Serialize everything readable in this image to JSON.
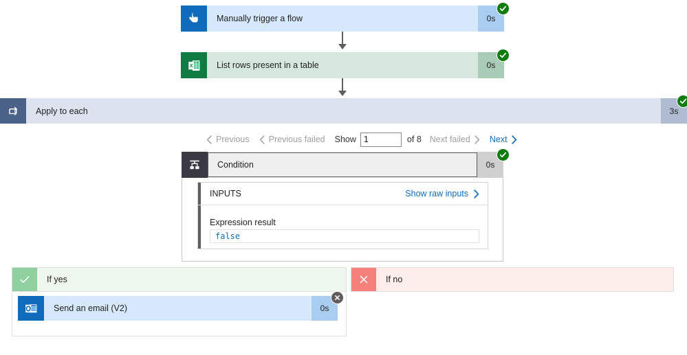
{
  "flow": {
    "trigger": {
      "title": "Manually trigger a flow",
      "duration": "0s",
      "icon": "tap-hand-icon",
      "status": "succeeded"
    },
    "list_rows": {
      "title": "List rows present in a table",
      "duration": "0s",
      "icon": "excel-icon",
      "status": "succeeded"
    },
    "apply_to_each": {
      "title": "Apply to each",
      "duration": "3s",
      "icon": "loop-icon",
      "status": "succeeded"
    },
    "condition": {
      "title": "Condition",
      "duration": "0s",
      "icon": "condition-branch-icon",
      "status": "succeeded"
    },
    "send_email": {
      "title": "Send an email (V2)",
      "duration": "0s",
      "icon": "outlook-icon",
      "status": "skipped"
    }
  },
  "pagination": {
    "previous_label": "Previous",
    "previous_failed_label": "Previous failed",
    "show_label": "Show",
    "page_value": "1",
    "page_placeholder": "1",
    "of_label": "of 8",
    "total_pages": 8,
    "next_failed_label": "Next failed",
    "next_label": "Next"
  },
  "inputs_panel": {
    "header": "INPUTS",
    "show_raw_link": "Show raw inputs",
    "expression_label": "Expression result",
    "expression_value": "false"
  },
  "branches": {
    "yes": {
      "label": "If yes",
      "icon": "checkmark-icon"
    },
    "no": {
      "label": "If no",
      "icon": "cross-icon"
    }
  },
  "colors": {
    "accent_blue": "#0f6cbd",
    "success_green": "#107c10",
    "excel_green": "#107c41",
    "skipped_grey": "#605e5c",
    "yes_green": "#8fd19e",
    "no_red": "#f4817a"
  }
}
